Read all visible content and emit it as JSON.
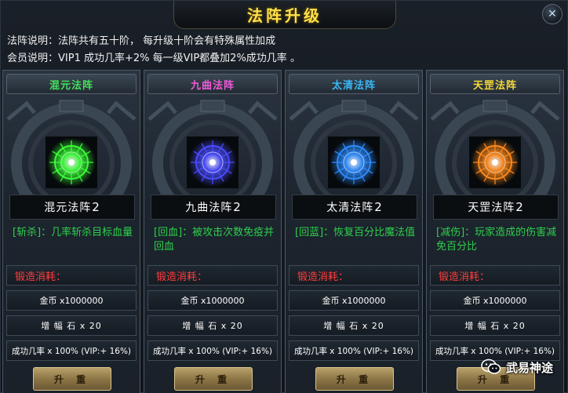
{
  "title": "法阵升级",
  "close_icon": "close-icon",
  "descriptions": {
    "line1": "法阵说明：法阵共有五十阶， 每升级十阶会有特殊属性加成",
    "line2": "会员说明：VIP1  成功几率+2%   每一级VIP都叠加2%成功几率 。"
  },
  "cost_title": "锻造消耗：",
  "upgrade_label": "升 重",
  "cards": [
    {
      "header": "混元法阵",
      "header_color": "#44e05a",
      "glow_color": "#3cff3a",
      "name": "混元法阵",
      "level": "2",
      "effect": "[斩杀]：几率斩杀目标血量",
      "gold": "金币 x1000000",
      "stone": "增 幅 石 x 20",
      "rate": "成功几率 x 100% (VIP:+ 16%)"
    },
    {
      "header": "九曲法阵",
      "header_color": "#f25ad8",
      "glow_color": "#4a4cff",
      "name": "九曲法阵",
      "level": "2",
      "effect": "[回血]：被攻击次数免疫并回血",
      "gold": "金币 x1000000",
      "stone": "增 幅 石 x 20",
      "rate": "成功几率 x 100% (VIP:+ 16%)"
    },
    {
      "header": "太清法阵",
      "header_color": "#39b7f5",
      "glow_color": "#2e8cff",
      "name": "太清法阵",
      "level": "2",
      "effect": "[回蓝]：恢复百分比魔法值",
      "gold": "金币 x1000000",
      "stone": "增 幅 石 x 20",
      "rate": "成功几率 x 100% (VIP:+ 16%)"
    },
    {
      "header": "天罡法阵",
      "header_color": "#f4d83c",
      "glow_color": "#ff8a1c",
      "name": "天罡法阵",
      "level": "2",
      "effect": "[减伤]：玩家造成的伤害减免百分比",
      "gold": "金币 x1000000",
      "stone": "增 幅 石 x 20",
      "rate": "成功几率 x 100% (VIP:+ 16%)"
    }
  ],
  "watermark": {
    "icon": "wechat-icon",
    "text": "武易神途"
  }
}
